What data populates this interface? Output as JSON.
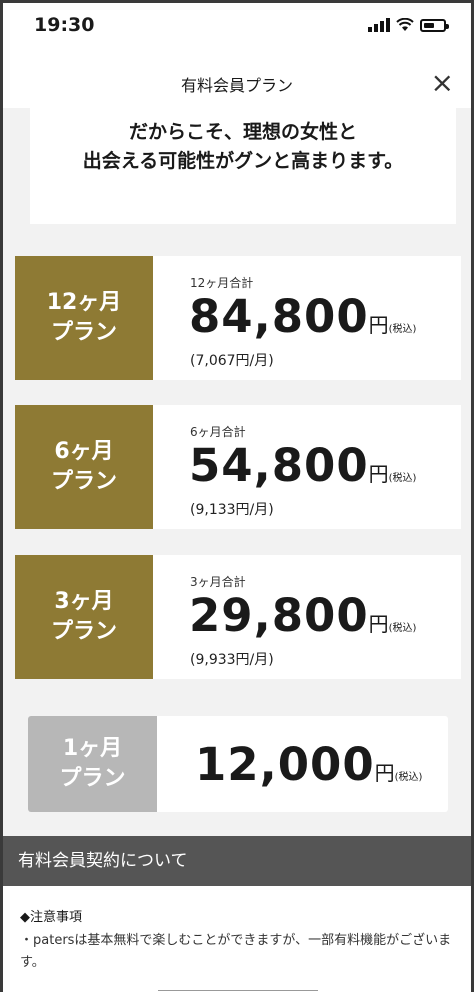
{
  "status_bar": {
    "time": "19:30"
  },
  "navbar": {
    "title": "有料会員プラン",
    "close_symbol": "×"
  },
  "hero": {
    "line1": "だからこそ、理想の女性と",
    "line2": "出会える可能性がグンと高まります。"
  },
  "colors": {
    "badge_gold": "#8e7a34",
    "badge_gray": "#b7b7b7",
    "section_header": "#555555"
  },
  "plans": [
    {
      "badge_line1": "12ヶ月",
      "badge_line2": "プラン",
      "total_label": "12ヶ月合計",
      "price": "84,800",
      "yen": "円",
      "tax": "(税込)",
      "monthly": "(7,067円/月)"
    },
    {
      "badge_line1": "6ヶ月",
      "badge_line2": "プラン",
      "total_label": "6ヶ月合計",
      "price": "54,800",
      "yen": "円",
      "tax": "(税込)",
      "monthly": "(9,133円/月)"
    },
    {
      "badge_line1": "3ヶ月",
      "badge_line2": "プラン",
      "total_label": "3ヶ月合計",
      "price": "29,800",
      "yen": "円",
      "tax": "(税込)",
      "monthly": "(9,933円/月)"
    },
    {
      "badge_line1": "1ヶ月",
      "badge_line2": "プラン",
      "price": "12,000",
      "yen": "円",
      "tax": "(税込)"
    }
  ],
  "terms": {
    "header": "有料会員契約について",
    "heading": "◆注意事項",
    "note": "・patersは基本無料で楽しむことができますが、一部有料機能がございます。"
  }
}
